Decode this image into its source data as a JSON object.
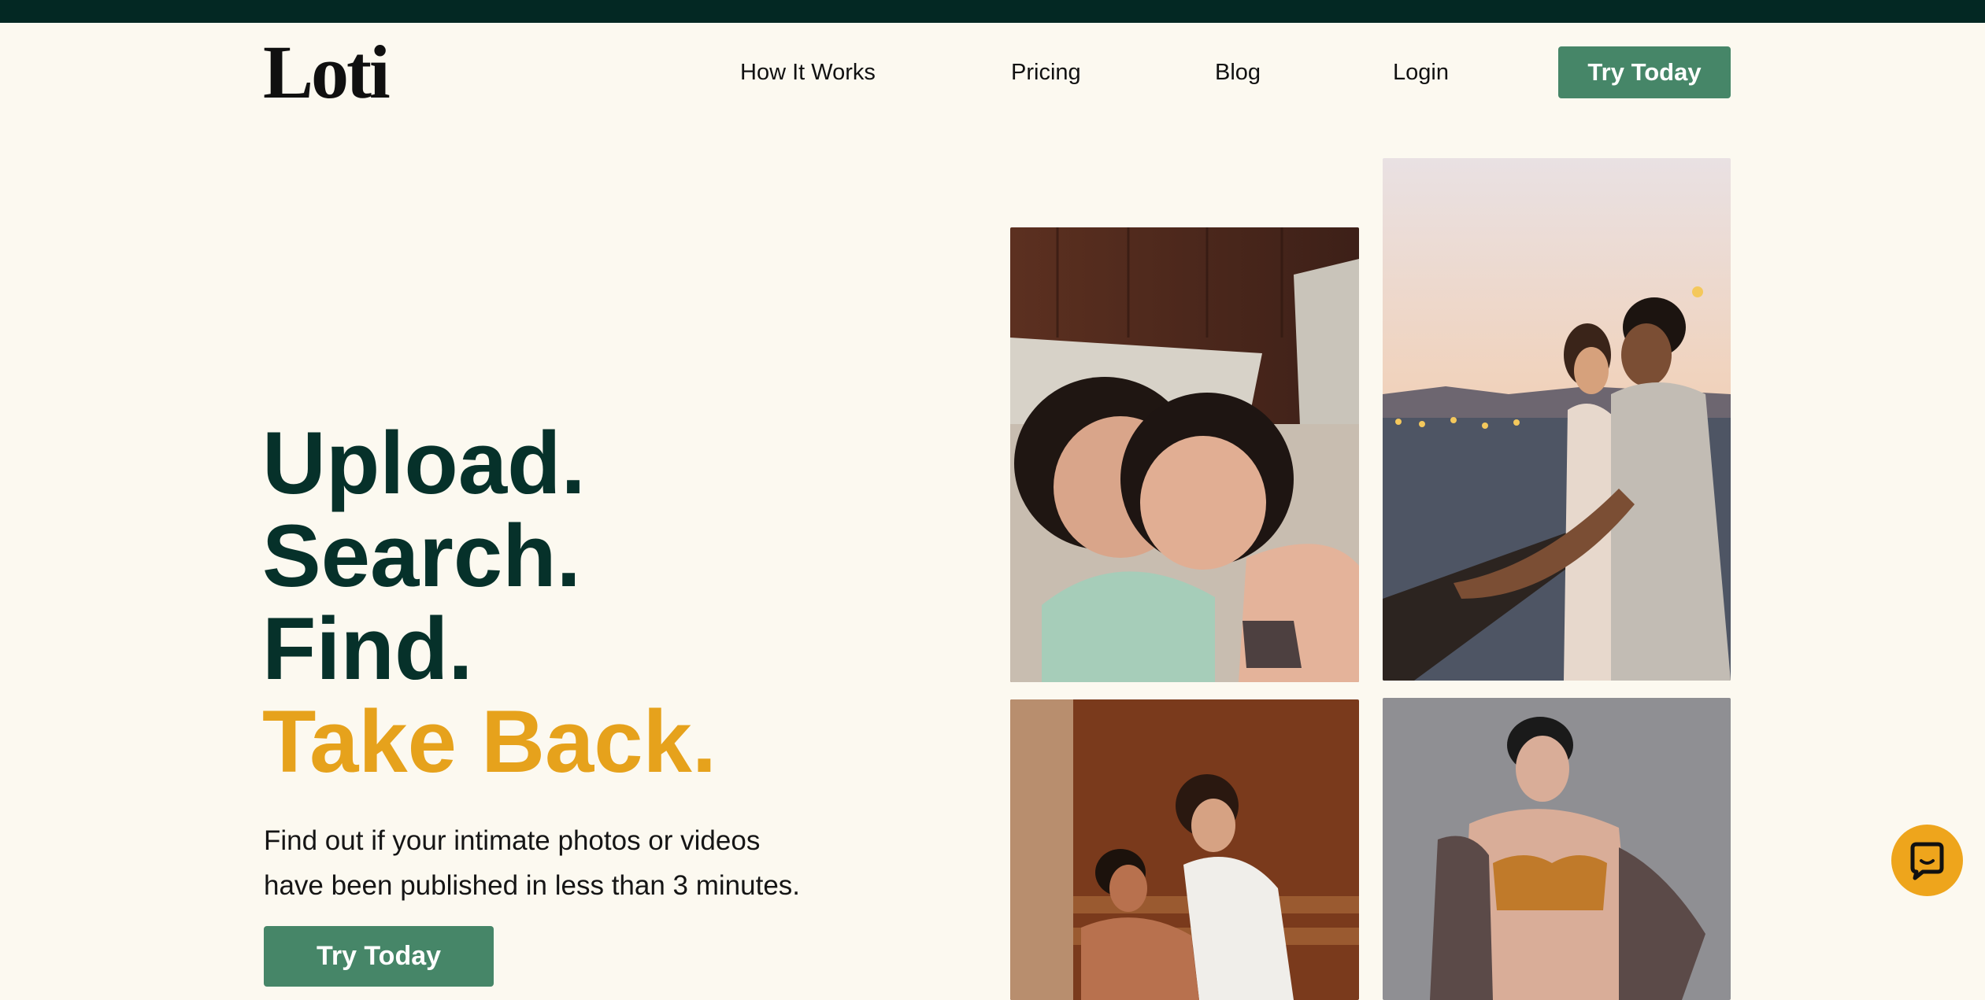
{
  "header": {
    "logo_text": "Loti",
    "nav": [
      {
        "label": "How It Works"
      },
      {
        "label": "Pricing"
      },
      {
        "label": "Blog"
      },
      {
        "label": "Login"
      }
    ],
    "cta_label": "Try Today"
  },
  "hero": {
    "lines": [
      "Upload.",
      "Search.",
      "Find.",
      "Take Back."
    ],
    "subtext_line1": "Find out if your intimate photos or videos",
    "subtext_line2": "have been published in less than 3 minutes.",
    "cta_label": "Try Today"
  },
  "colors": {
    "background": "#fcf9f0",
    "top_strip": "#032823",
    "heading": "#06312a",
    "accent": "#e6a21c",
    "button": "#468668",
    "chat_button": "#eea51c"
  },
  "icons": {
    "chat": "chat-bubble-icon"
  }
}
